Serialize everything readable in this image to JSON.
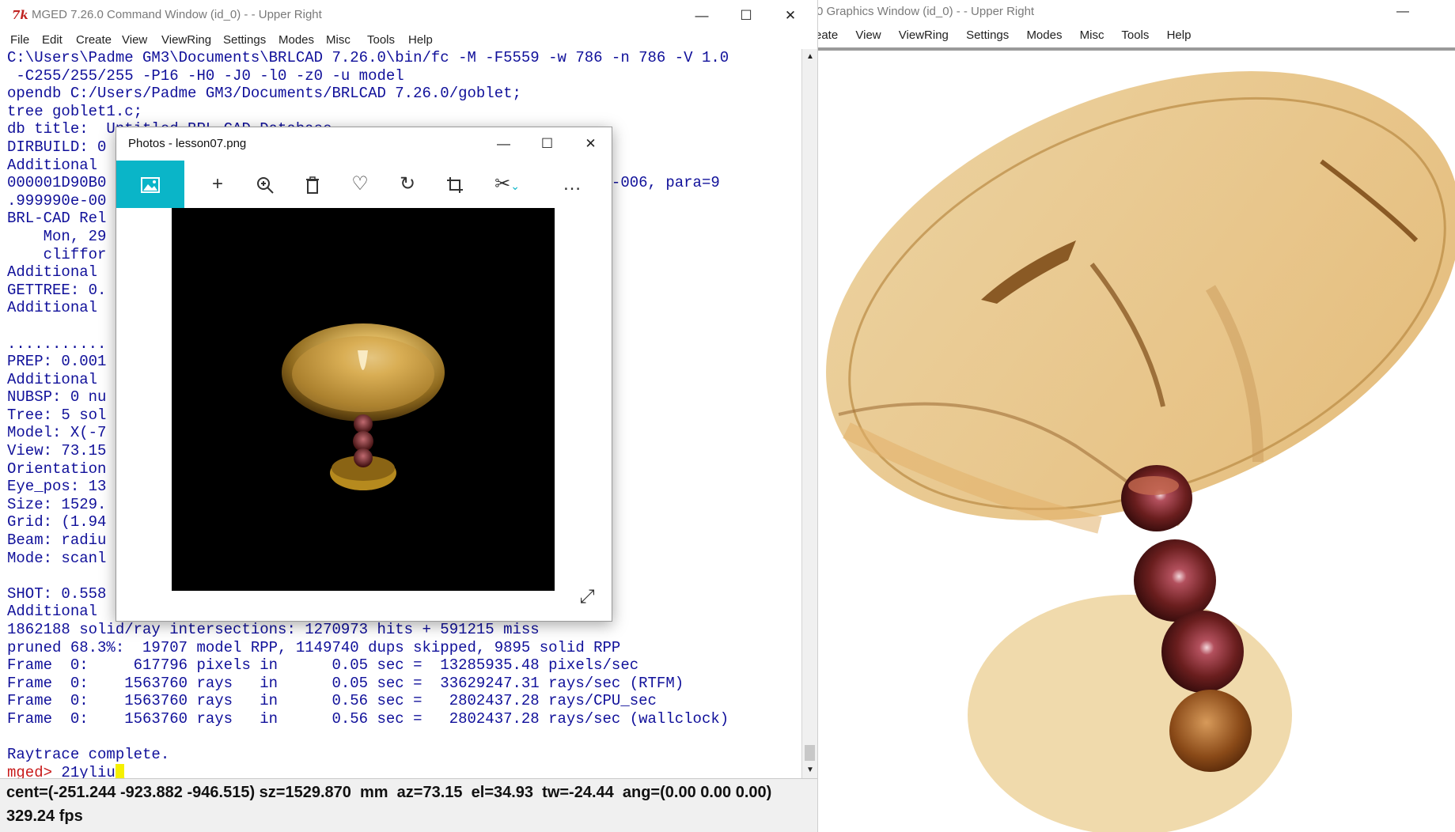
{
  "graphics_window": {
    "title": "0 Graphics Window (id_0) -  - Upper Right",
    "menus": [
      "eate",
      "View",
      "ViewRing",
      "Settings",
      "Modes",
      "Misc",
      "Tools",
      "Help"
    ],
    "minimize": "—",
    "accent_bowl": "#e8c98a",
    "accent_bead": "#6a1e1e"
  },
  "command_window": {
    "app_icon": "7k",
    "title": "MGED 7.26.0 Command Window (id_0) -  - Upper Right",
    "minimize": "—",
    "maximize": "☐",
    "close": "✕",
    "menus": [
      "File",
      "Edit",
      "Create",
      "View",
      "ViewRing",
      "Settings",
      "Modes",
      "Misc",
      "Tools",
      "Help"
    ],
    "console_lines": [
      "C:\\Users\\Padme GM3\\Documents\\BRLCAD 7.26.0\\bin/fc -M -F5559 -w 786 -n 786 -V 1.0",
      " -C255/255/255 -P16 -H0 -J0 -l0 -z0 -u model",
      "opendb C:/Users/Padme GM3/Documents/BRLCAD 7.26.0/goblet;",
      "tree goblet1.c;",
      "db title:  Untitled BRL-CAD Database",
      "DIRBUILD: 0",
      "Additional                                                 ",
      "000001D90B0                                                 000000e-006, para=9",
      ".999990e-00",
      "BRL-CAD Rel",
      "    Mon, 29                                                 ion 0",
      "    cliffor",
      "Additional",
      "GETTREE: 0.",
      "Additional",
      "",
      "...........",
      "PREP: 0.001",
      "Additional",
      "NUBSP: 0 nu",
      "Tree: 5 sol",
      "Model: X(-7",
      "View: 73.15",
      "Orientation",
      "Eye_pos: 13",
      "Size: 1529.",
      "Grid: (1.94",
      "Beam: radiu",
      "Mode: scanl",
      "",
      "SHOT: 0.558",
      "Additional",
      "1862188 solid/ray intersections: 1270973 hits + 591215 miss",
      "pruned 68.3%:  19707 model RPP, 1149740 dups skipped, 9895 solid RPP",
      "Frame  0:     617796 pixels in      0.05 sec =  13285935.48 pixels/sec",
      "Frame  0:    1563760 rays   in      0.05 sec =  33629247.31 rays/sec (RTFM)",
      "Frame  0:    1563760 rays   in      0.56 sec =   2802437.28 rays/CPU_sec",
      "Frame  0:    1563760 rays   in      0.56 sec =   2802437.28 rays/sec (wallclock)",
      "",
      "Raytrace complete."
    ],
    "prompt": "mged>",
    "input_value": "21yliu",
    "status_line": "cent=(-251.244 -923.882 -946.515) sz=1529.870  mm  az=73.15  el=34.93  tw=-24.44  ang=(0.00 0.00 0.00)",
    "fps": "329.24 fps",
    "text_color": "#10109a",
    "prompt_color": "#c81a1a"
  },
  "photos_window": {
    "title": "Photos - lesson07.png",
    "minimize": "—",
    "maximize": "☐",
    "close": "✕",
    "toolbar_icons": [
      "image-icon",
      "add-icon",
      "zoom-in-icon",
      "delete-icon",
      "favorite-icon",
      "rotate-icon",
      "crop-icon",
      "edit-icon",
      "more-icon"
    ],
    "more": "…",
    "expand": "⤢",
    "accent": "#0ab5c8"
  }
}
